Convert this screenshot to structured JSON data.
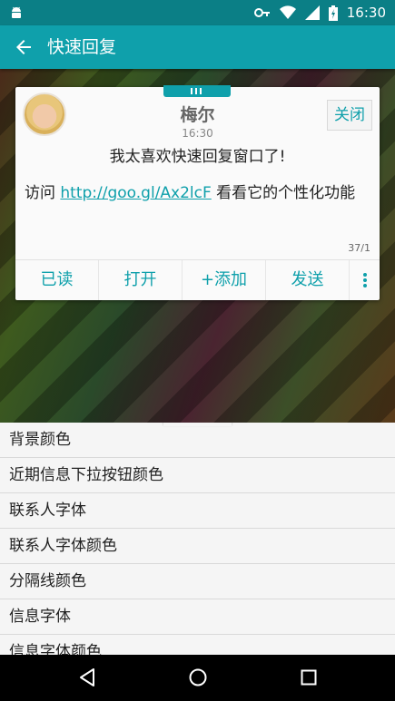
{
  "status_bar": {
    "time": "16:30"
  },
  "app_bar": {
    "title": "快速回复"
  },
  "card": {
    "name": "梅尔",
    "time": "16:30",
    "message_line1": "我太喜欢快速回复窗口了!",
    "message_prefix": "访问 ",
    "message_link": "http://goo.gl/Ax2lcF",
    "message_suffix": " 看看它的个性化功能",
    "counter": "37/1",
    "close_label": "关闭",
    "actions": {
      "read": "已读",
      "open": "打开",
      "add": "+添加",
      "send": "发送"
    }
  },
  "settings": {
    "items": [
      "背景颜色",
      "近期信息下拉按钮颜色",
      "联系人字体",
      "联系人字体颜色",
      "分隔线颜色",
      "信息字体",
      "信息字体颜色"
    ]
  },
  "colors": {
    "accent": "#0fa0ab",
    "status_bar": "#0b7f86"
  }
}
